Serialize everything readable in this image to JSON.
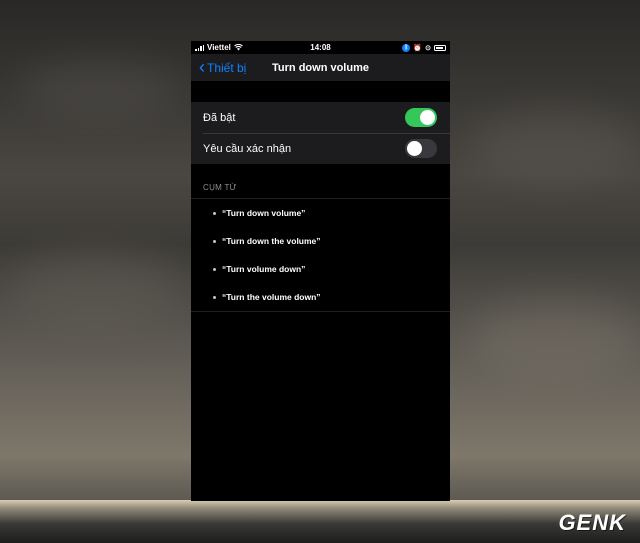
{
  "status_bar": {
    "carrier": "Viettel",
    "time": "14:08"
  },
  "nav": {
    "back_label": "Thiết bị",
    "title": "Turn down volume"
  },
  "settings": [
    {
      "label": "Đã bật",
      "enabled": true
    },
    {
      "label": "Yêu cầu xác nhận",
      "enabled": false
    }
  ],
  "phrases": {
    "header": "CỤM TỪ",
    "items": [
      "“Turn down volume”",
      "“Turn down the volume”",
      "“Turn volume down”",
      "“Turn the volume down”"
    ]
  },
  "watermark": "GENK",
  "colors": {
    "accent": "#0a84ff",
    "toggle_on": "#34c759",
    "toggle_off": "#39393d"
  }
}
